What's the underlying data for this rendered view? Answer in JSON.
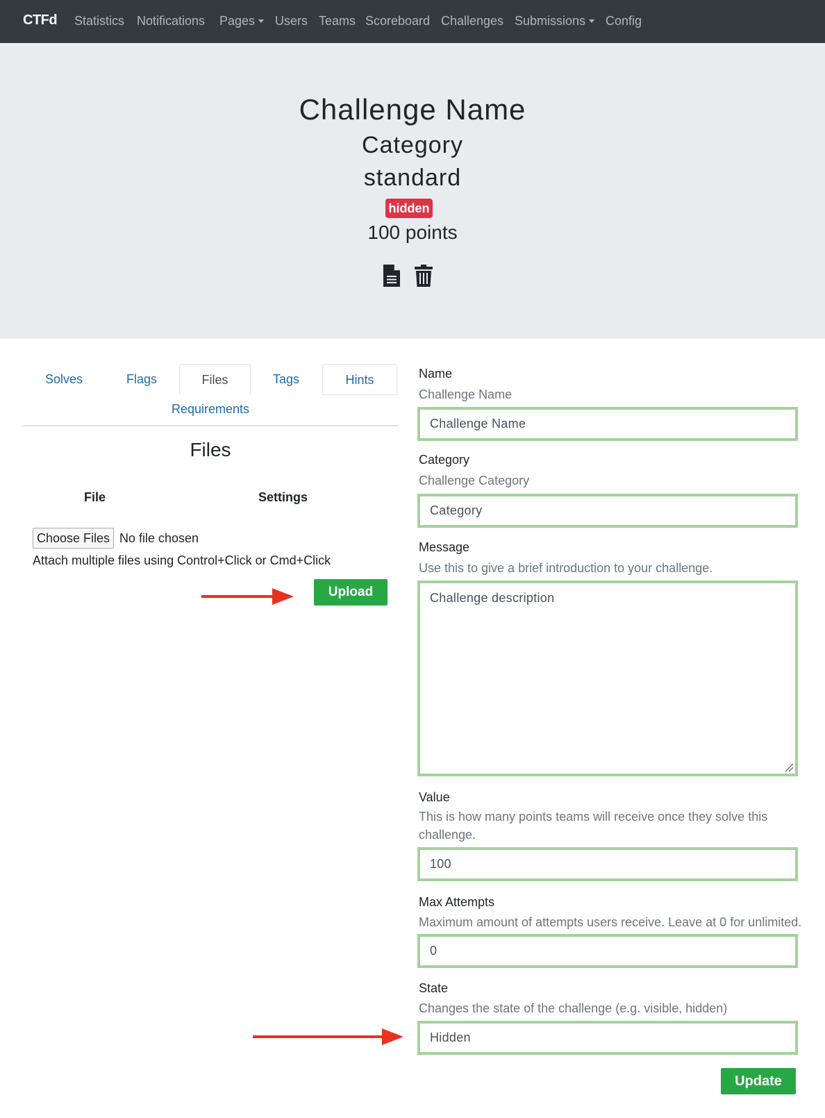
{
  "navbar": {
    "brand": "CTFd",
    "items": [
      "Statistics",
      "Notifications",
      "Pages",
      "Users",
      "Teams",
      "Scoreboard",
      "Challenges",
      "Submissions",
      "Config"
    ]
  },
  "header": {
    "title": "Challenge Name",
    "category": "Category",
    "type": "standard",
    "state_badge": "hidden",
    "points": "100 points"
  },
  "tabs": [
    "Solves",
    "Flags",
    "Files",
    "Tags",
    "Hints",
    "Requirements"
  ],
  "files_panel": {
    "heading": "Files",
    "col_file": "File",
    "col_settings": "Settings",
    "choose_button": "Choose Files",
    "no_file": "No file chosen",
    "hint": "Attach multiple files using Control+Click or Cmd+Click",
    "upload_button": "Upload"
  },
  "form": {
    "name": {
      "label": "Name",
      "help": "Challenge Name",
      "value": "Challenge Name"
    },
    "category": {
      "label": "Category",
      "help": "Challenge Category",
      "value": "Category"
    },
    "message": {
      "label": "Message",
      "help": "Use this to give a brief introduction to your challenge.",
      "value": "Challenge description"
    },
    "value": {
      "label": "Value",
      "help": "This is how many points teams will receive once they solve this challenge.",
      "value": "100"
    },
    "max_attempts": {
      "label": "Max Attempts",
      "help": "Maximum amount of attempts users receive. Leave at 0 for unlimited.",
      "value": "0"
    },
    "state": {
      "label": "State",
      "help": "Changes the state of the challenge (e.g. visible, hidden)",
      "value": "Hidden"
    },
    "update_button": "Update"
  },
  "colors": {
    "navbar_bg": "#343a40",
    "jumbotron_bg": "#e9ecef",
    "badge_danger": "#dc3545",
    "success": "#28a745",
    "field_border": "#a3d39c",
    "link": "#1f6aa8",
    "annotation_arrow": "#e8321f"
  },
  "icons": [
    "document-icon",
    "trash-icon",
    "caret-down-icon",
    "annotation-arrow-icon",
    "resize-grip-icon"
  ]
}
